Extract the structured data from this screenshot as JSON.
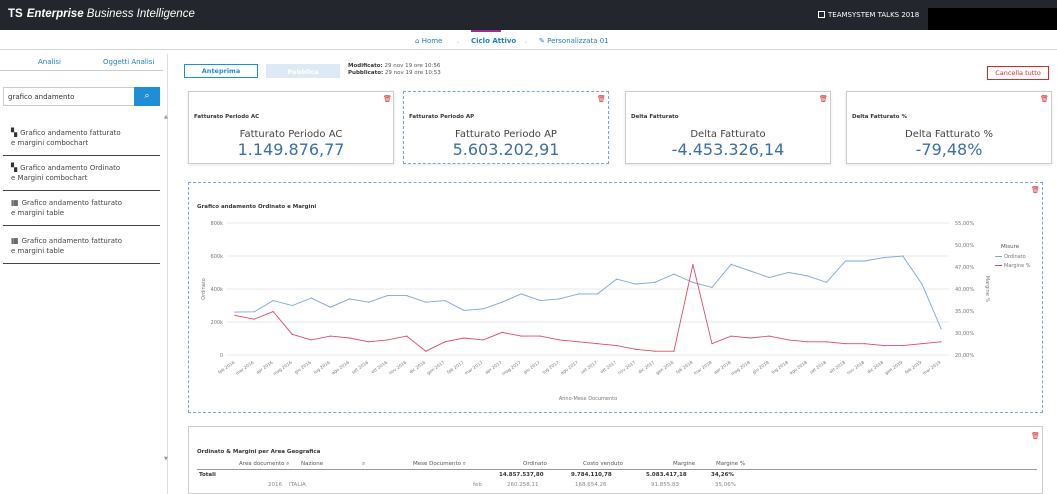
{
  "app": {
    "brand_logo": "TS",
    "brand_bold": "Enterprise",
    "brand_rest": "Business Intelligence",
    "event": "TEAMSYSTEM TALKS 2018"
  },
  "nav": {
    "home": "Home",
    "sep": ".",
    "active": "Ciclo Attivo",
    "custom": "Personalizzata 01"
  },
  "sidebar": {
    "tabs": [
      "Analisi",
      "Oggetti Analisi"
    ],
    "search_value": "grafico andamento",
    "items": [
      {
        "icon": "combochart-icon",
        "line1": "Grafico andamento fatturato",
        "line2": "e margini combochart"
      },
      {
        "icon": "combochart-icon",
        "line1": "Grafico andamento Ordinato",
        "line2": "e Margini combochart"
      },
      {
        "icon": "table-icon",
        "line1": "Grafico andamento fatturato",
        "line2": "e margini table"
      },
      {
        "icon": "table-icon",
        "line1": "Grafico andamento fatturato",
        "line2": "e margini table"
      }
    ]
  },
  "toolbar": {
    "preview": "Anteprima",
    "publish": "Pubblica",
    "modified_label": "Modificato:",
    "modified_value": "29 nov 19 ore 10:56",
    "published_label": "Pubblicato:",
    "published_value": "29 nov 19 ore 10:53",
    "clear": "Cancella tutto"
  },
  "kpis": [
    {
      "title": "Fatturato Periodo AC",
      "name": "Fatturato Periodo AC",
      "value": "1.149.876,77"
    },
    {
      "title": "Fatturato Periodo AP",
      "name": "Fatturato Periodo AP",
      "value": "5.603.202,91"
    },
    {
      "title": "Delta Fatturato",
      "name": "Delta Fatturato",
      "value": "-4.453.326,14"
    },
    {
      "title": "Delta Fatturato %",
      "name": "Delta Fatturato %",
      "value": "-79,48%"
    }
  ],
  "chart_data": {
    "type": "line",
    "title": "Grafico andamento Ordinato e Margini",
    "xlabel": "Anno-Mese Documento",
    "ylabel": "Ordinato",
    "y2label": "Margine %",
    "legend_title": "Misure",
    "legend_position": "right",
    "grid": true,
    "ylim": [
      0,
      800000
    ],
    "y_ticks": [
      "0",
      "200k",
      "400k",
      "600k",
      "800k"
    ],
    "y2lim": [
      20,
      55
    ],
    "y2_ticks": [
      "20,00%",
      "30,00%",
      "35,00%",
      "40,00%",
      "47,00%",
      "50,00%",
      "55,00%"
    ],
    "x": [
      "feb 2016",
      "mar 2016",
      "apr 2016",
      "mag 2016",
      "giu 2016",
      "lug 2016",
      "ago 2016",
      "set 2016",
      "ott 2016",
      "nov 2016",
      "dic 2016",
      "gen 2017",
      "feb 2017",
      "mar 2017",
      "apr 2017",
      "mag 2017",
      "giu 2017",
      "lug 2017",
      "ago 2017",
      "set 2017",
      "ott 2017",
      "nov 2017",
      "dic 2017",
      "gen 2018",
      "feb 2018",
      "mar 2018",
      "apr 2018",
      "mag 2018",
      "giu 2018",
      "lug 2018",
      "ago 2018",
      "set 2018",
      "ott 2018",
      "nov 2018",
      "dic 2018",
      "gen 2019",
      "feb 2019",
      "mar 2019"
    ],
    "series": [
      {
        "name": "Ordinato",
        "axis": "left",
        "color": "#7ea6d8",
        "values": [
          260000,
          262000,
          330000,
          300000,
          345000,
          290000,
          340000,
          320000,
          360000,
          360000,
          320000,
          330000,
          270000,
          280000,
          320000,
          370000,
          330000,
          340000,
          370000,
          370000,
          460000,
          430000,
          440000,
          490000,
          440000,
          410000,
          550000,
          510000,
          470000,
          500000,
          480000,
          440000,
          570000,
          570000,
          590000,
          600000,
          430000,
          160000
        ]
      },
      {
        "name": "Margine %",
        "axis": "right",
        "color": "#e04a6a",
        "values": [
          30.5,
          29.5,
          31.5,
          25.5,
          24,
          25,
          24.5,
          23.5,
          24,
          25,
          21,
          23.5,
          24.5,
          24,
          26,
          25,
          25,
          24,
          23.5,
          23,
          22.5,
          21.5,
          21,
          21,
          44,
          23,
          25,
          24.5,
          25,
          24,
          23.5,
          23.5,
          23,
          23,
          22.5,
          22.5,
          23,
          23.5
        ]
      }
    ]
  },
  "table": {
    "title": "Ordinato & Margini per Area Geografica",
    "headers": [
      "Area documento",
      "Nazione",
      "Mese Documento",
      "Ordinato",
      "Costo venduto",
      "Margine",
      "Margine %"
    ],
    "total_label": "Totali",
    "total_values": [
      "14.857.537,80",
      "9.784.110,78",
      "5.083.417,18",
      "34,26%"
    ],
    "row1": {
      "area": "2016",
      "nation": "ITALIA",
      "month": "feb",
      "values": [
        "260.258,11",
        "168.654,26",
        "91.855,83",
        "35,06%"
      ]
    }
  }
}
